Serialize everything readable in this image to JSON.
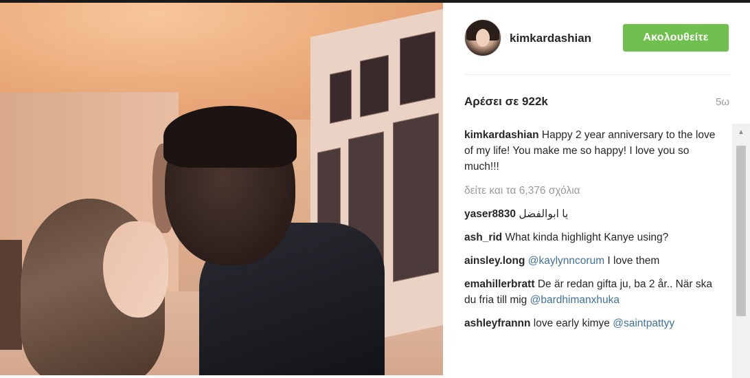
{
  "post": {
    "username": "kimkardashian",
    "follow_label": "Ακολουθείτε",
    "likes": "Αρέσει σε 922k",
    "time": "5ω",
    "caption": {
      "user": "kimkardashian",
      "text": "Happy 2 year anniversary to the love of my life! You make me so happy! I love you so much!!!"
    },
    "view_all_comments": "δείτε και τα 6,376 σχόλια"
  },
  "comments": [
    {
      "user": "yaser8830",
      "text": "يا ابوالفضل",
      "mention": ""
    },
    {
      "user": "ash_rid",
      "text": "What kinda highlight Kanye using?",
      "mention": ""
    },
    {
      "user": "ainsley.long",
      "text": "I love them",
      "mention": "@kaylynncorum"
    },
    {
      "user": "emahillerbratt",
      "text": "De är redan gifta ju, ba 2 år.. När ska du fria till mig",
      "mention": "@bardhimanxhuka"
    },
    {
      "user": "ashleyfrannn",
      "text": "love early kimye",
      "mention": "@saintpattyy"
    }
  ],
  "colors": {
    "follow_button": "#70c050",
    "mention": "#3f729b",
    "muted": "#999999"
  }
}
